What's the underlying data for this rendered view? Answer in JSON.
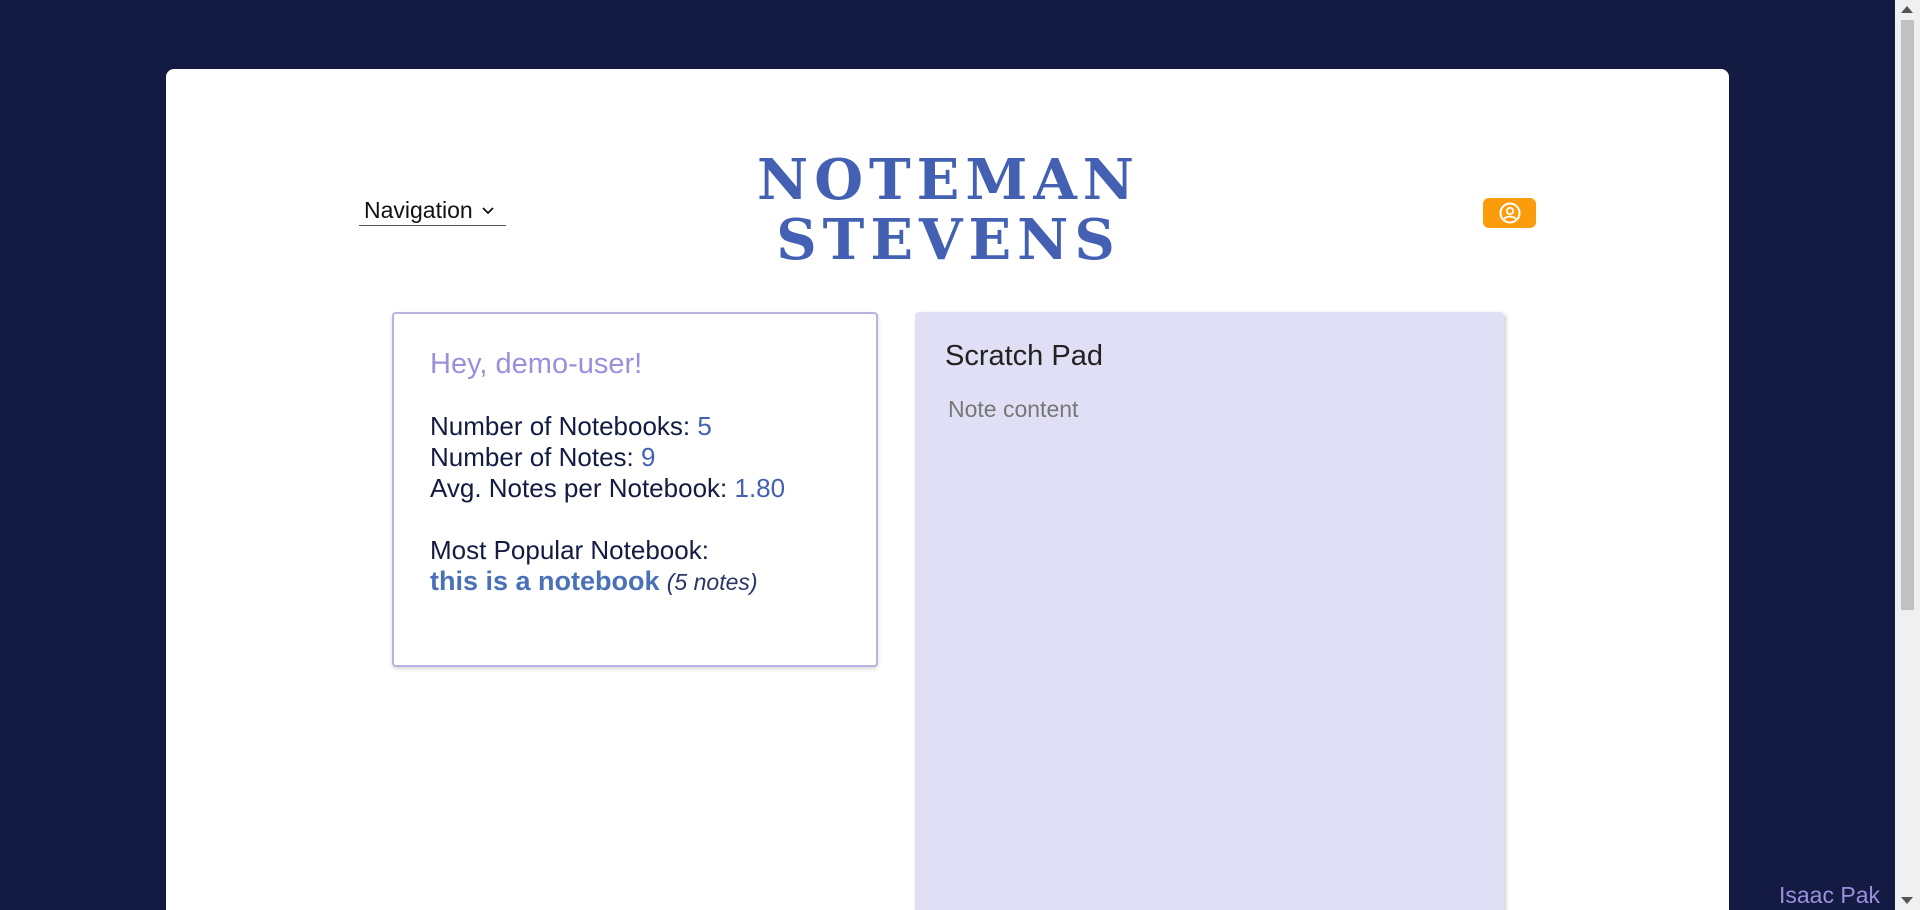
{
  "header": {
    "navigation_label": "Navigation",
    "logo_line1": "NOTEMAN",
    "logo_line2": "STEVENS"
  },
  "stats": {
    "greeting": "Hey, demo-user!",
    "notebooks_label": "Number of Notebooks: ",
    "notebooks_value": "5",
    "notes_label": "Number of Notes: ",
    "notes_value": "9",
    "avg_label": "Avg. Notes per Notebook: ",
    "avg_value": "1.80",
    "popular_label": "Most Popular Notebook:",
    "popular_name": "this is a notebook",
    "popular_count": "(5 notes)"
  },
  "scratch_pad": {
    "title": "Scratch Pad",
    "placeholder": "Note content",
    "value": ""
  },
  "footer": {
    "credit": "Isaac Pak"
  },
  "colors": {
    "background": "#131b42",
    "accent": "#4360b3",
    "greeting": "#9d8fdc",
    "profile_button": "#fb9c0c",
    "scratch_bg": "#e1dff5"
  },
  "icons": {
    "navigation_chevron": "chevron-down-icon",
    "profile": "user-circle-icon"
  }
}
